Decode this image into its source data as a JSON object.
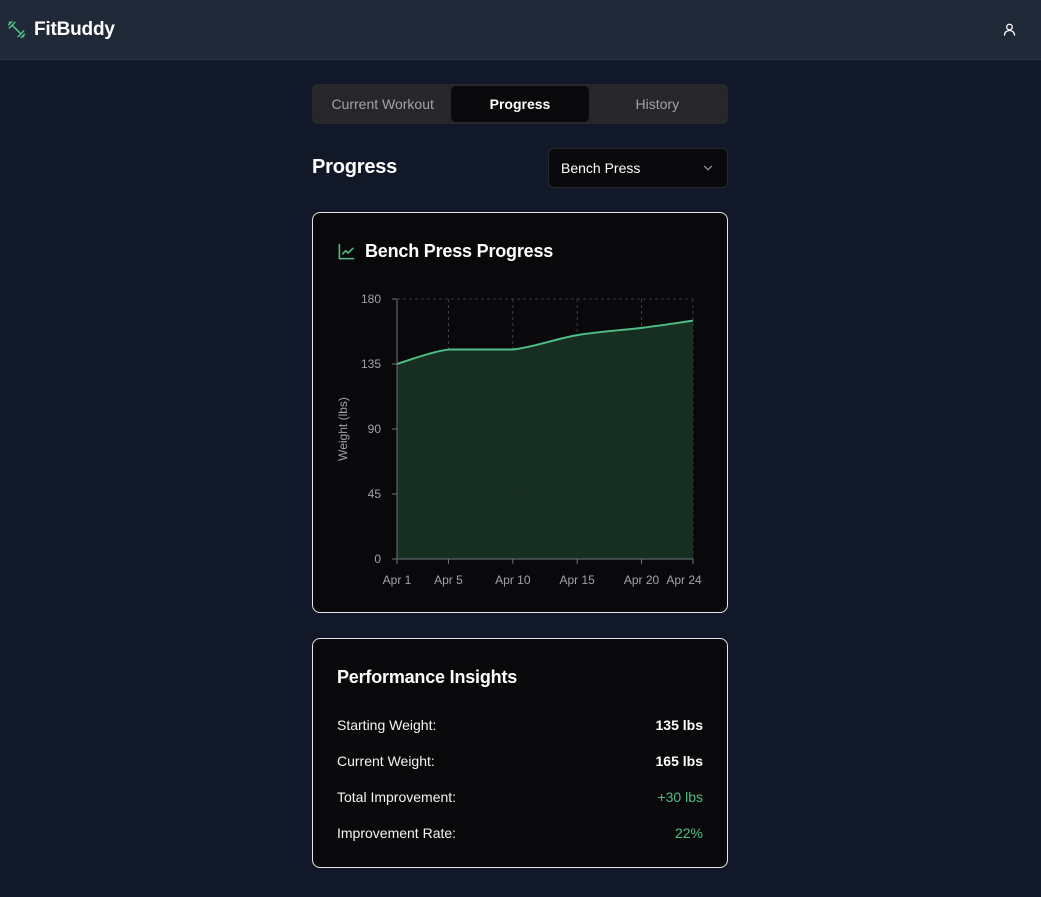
{
  "app": {
    "name": "FitBuddy"
  },
  "tabs": [
    {
      "label": "Current Workout",
      "active": false
    },
    {
      "label": "Progress",
      "active": true
    },
    {
      "label": "History",
      "active": false
    }
  ],
  "page": {
    "title": "Progress"
  },
  "exercise_select": {
    "value": "Bench Press"
  },
  "chart_card": {
    "title": "Bench Press Progress",
    "icon": "line-chart-icon"
  },
  "chart_data": {
    "type": "area",
    "title": "Bench Press Progress",
    "xlabel": "",
    "ylabel": "Weight (lbs)",
    "x": [
      "Apr 1",
      "Apr 5",
      "Apr 10",
      "Apr 15",
      "Apr 20",
      "Apr 24"
    ],
    "x_ticks": [
      "Apr 1",
      "Apr 5",
      "Apr 10",
      "Apr 15",
      "Apr 20",
      "Apr 24"
    ],
    "series": [
      {
        "values": [
          135,
          145,
          145,
          155,
          160,
          165
        ]
      }
    ],
    "ylim": [
      0,
      180
    ],
    "y_ticks": [
      0,
      45,
      90,
      135,
      180
    ],
    "grid": true,
    "colors": {
      "line": "#4fbf86",
      "fill": "#183024"
    }
  },
  "insights": {
    "title": "Performance Insights",
    "rows": [
      {
        "label": "Starting Weight:",
        "value": "135 lbs",
        "accent": false
      },
      {
        "label": "Current Weight:",
        "value": "165 lbs",
        "accent": false
      },
      {
        "label": "Total Improvement:",
        "value": "+30 lbs",
        "accent": true
      },
      {
        "label": "Improvement Rate:",
        "value": "22%",
        "accent": true
      }
    ]
  },
  "colors": {
    "background": "#111827",
    "topbar": "#1f2937",
    "card": "#09090b",
    "accent": "#4fbf86"
  }
}
